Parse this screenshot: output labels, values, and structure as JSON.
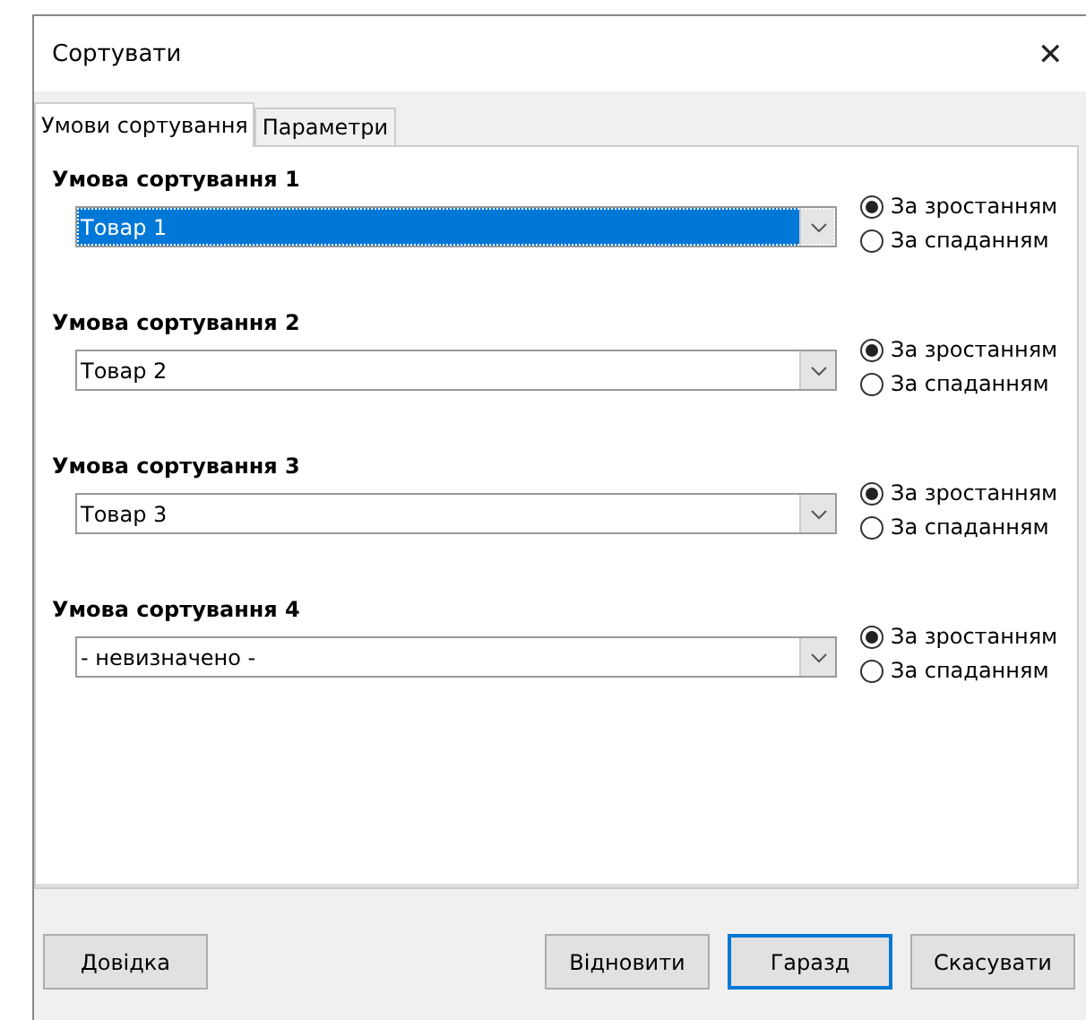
{
  "window": {
    "title": "Сортувати",
    "close": "✕"
  },
  "tabs": [
    {
      "label": "Умови сортування",
      "selected": true
    },
    {
      "label": "Параметри",
      "selected": false
    }
  ],
  "conditions": [
    {
      "heading": "Умова сортування 1",
      "value": "Товар 1",
      "focused": true,
      "options": [
        {
          "label": "За зростанням",
          "selected": true
        },
        {
          "label": "За спаданням",
          "selected": false
        }
      ]
    },
    {
      "heading": "Умова сортування 2",
      "value": "Товар 2",
      "focused": false,
      "options": [
        {
          "label": "За зростанням",
          "selected": true
        },
        {
          "label": "За спаданням",
          "selected": false
        }
      ]
    },
    {
      "heading": "Умова сортування 3",
      "value": "Товар 3",
      "focused": false,
      "options": [
        {
          "label": "За зростанням",
          "selected": true
        },
        {
          "label": "За спаданням",
          "selected": false
        }
      ]
    },
    {
      "heading": "Умова сортування 4",
      "value": "- невизначено -",
      "focused": false,
      "options": [
        {
          "label": "За зростанням",
          "selected": true
        },
        {
          "label": "За спаданням",
          "selected": false
        }
      ]
    }
  ],
  "buttons": [
    {
      "label": "Довідка",
      "default": false
    },
    {
      "label": "Відновити",
      "default": false
    },
    {
      "label": "Гаразд",
      "default": true
    },
    {
      "label": "Скасувати",
      "default": false
    }
  ]
}
